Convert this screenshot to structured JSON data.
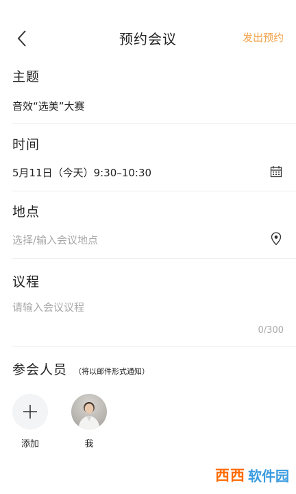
{
  "header": {
    "title": "预约会议",
    "send_label": "发出预约",
    "back_icon": "chevron-left-icon"
  },
  "topic": {
    "label": "主题",
    "value": "音效“选美”大赛"
  },
  "time": {
    "label": "时间",
    "value": "5月11日（今天）9:30–10:30",
    "icon": "calendar-icon"
  },
  "location": {
    "label": "地点",
    "placeholder": "选择/输入会议地点",
    "icon": "location-pin-icon"
  },
  "agenda": {
    "label": "议程",
    "placeholder": "请输入会议议程",
    "counter": "0/300"
  },
  "attendees": {
    "label": "参会人员",
    "note": "（将以邮件形式通知）",
    "add_label": "添加",
    "me_label": "我"
  },
  "watermark": {
    "brand": "西西",
    "text": "软件园",
    "site": "CR173.COM"
  },
  "colors": {
    "accent": "#f2a14a",
    "divider": "#ececec",
    "placeholder": "#a8a8a8"
  }
}
